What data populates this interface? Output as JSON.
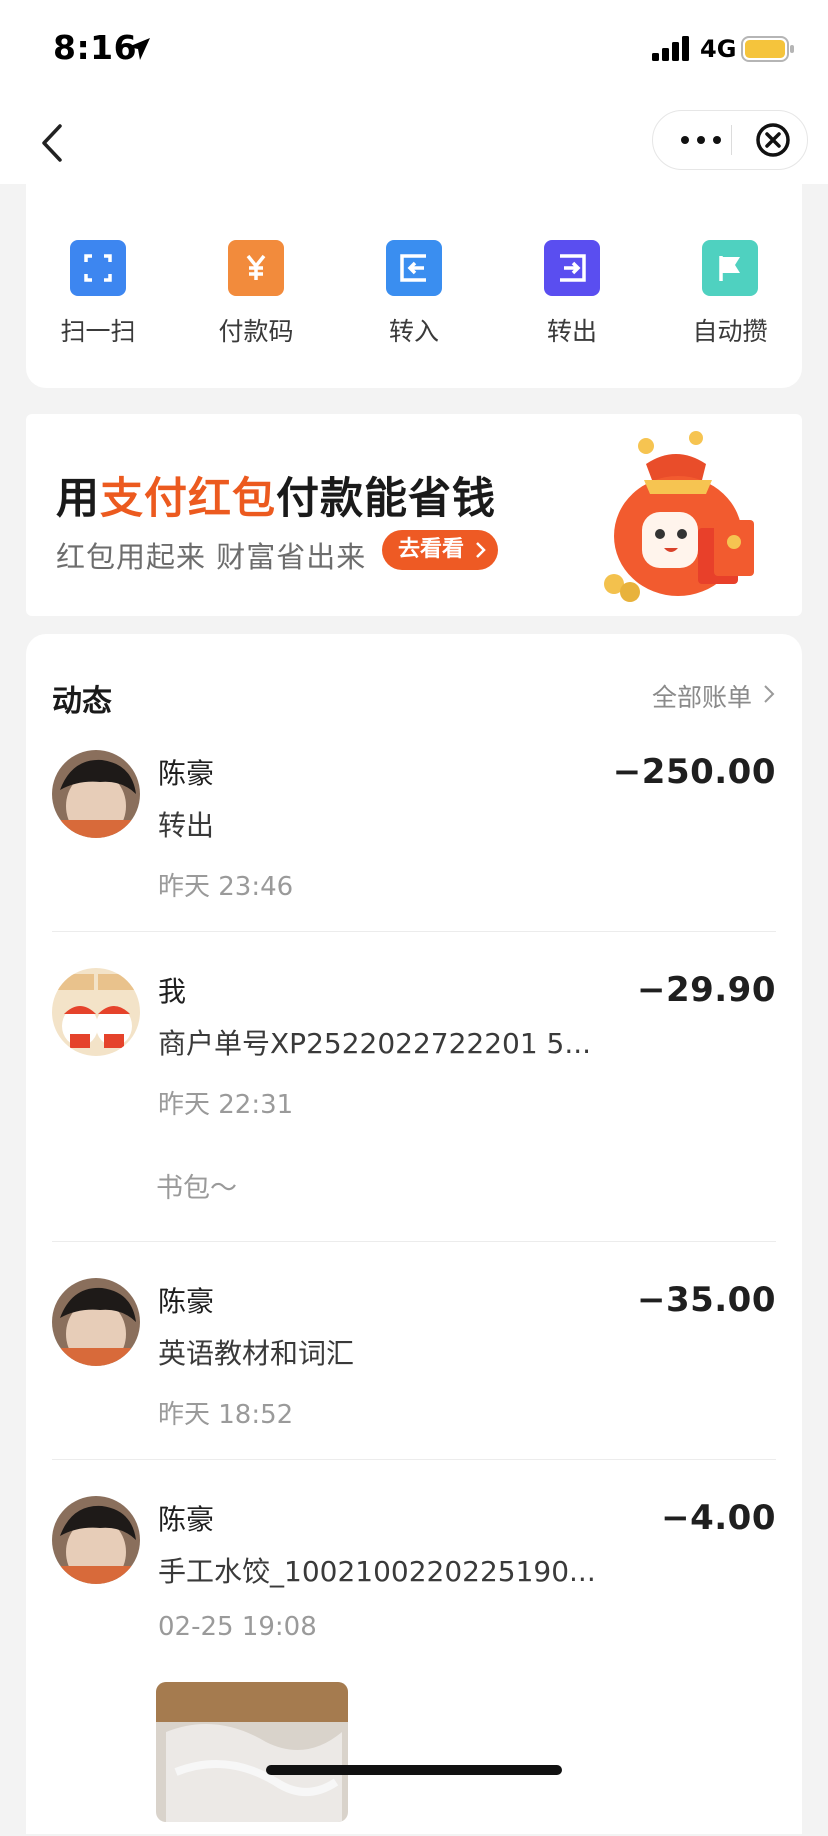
{
  "status_bar": {
    "time": "8:16",
    "network": "4G"
  },
  "actions": [
    {
      "label": "扫一扫",
      "icon": "scan-icon",
      "color": "#3d86f0"
    },
    {
      "label": "付款码",
      "icon": "payment-code-icon",
      "color": "#f28b3c"
    },
    {
      "label": "转入",
      "icon": "transfer-in-icon",
      "color": "#3a8ef0"
    },
    {
      "label": "转出",
      "icon": "transfer-out-icon",
      "color": "#5a4ef0"
    },
    {
      "label": "自动攒",
      "icon": "flag-icon",
      "color": "#4fd1c0"
    }
  ],
  "banner": {
    "headline_prefix": "用",
    "headline_highlight": "支付红包",
    "headline_suffix": "付款能省钱",
    "subtitle": "红包用起来 财富省出来",
    "button": "去看看"
  },
  "activity": {
    "title": "动态",
    "all_bills": "全部账单",
    "items": [
      {
        "name": "陈豪",
        "desc": "转出",
        "time": "昨天 23:46",
        "amount": "−250.00"
      },
      {
        "name": "我",
        "desc": "商户单号XP2522022722201 5...",
        "time": "昨天 22:31",
        "amount": "−29.90",
        "note": "书包～"
      },
      {
        "name": "陈豪",
        "desc": "英语教材和词汇",
        "time": "昨天 18:52",
        "amount": "−35.00"
      },
      {
        "name": "陈豪",
        "desc": "手工水饺_1002100220225190...",
        "time": "02-25 19:08",
        "amount": "−4.00"
      }
    ]
  },
  "colors": {
    "accent": "#ee5a24",
    "highlight": "#ec5a1f"
  }
}
